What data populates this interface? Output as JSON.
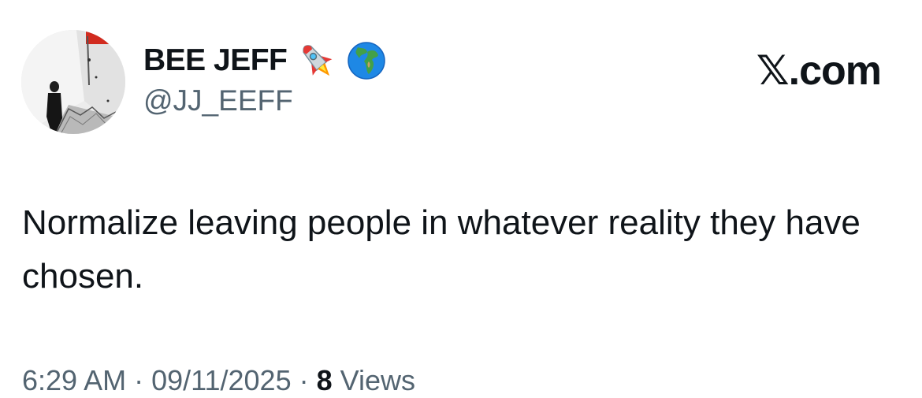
{
  "author": {
    "display_name": "BEE JEFF",
    "handle": "@JJ_EEFF",
    "name_emojis": [
      "rocket-emoji",
      "globe-emoji"
    ]
  },
  "brand": {
    "label": "𝕏.com"
  },
  "tweet": {
    "text": "Normalize leaving people in whatever reality they have chosen."
  },
  "meta": {
    "time": "6:29 AM",
    "separator": " · ",
    "date": "09/11/2025",
    "views_count": "8",
    "views_label": "Views"
  }
}
